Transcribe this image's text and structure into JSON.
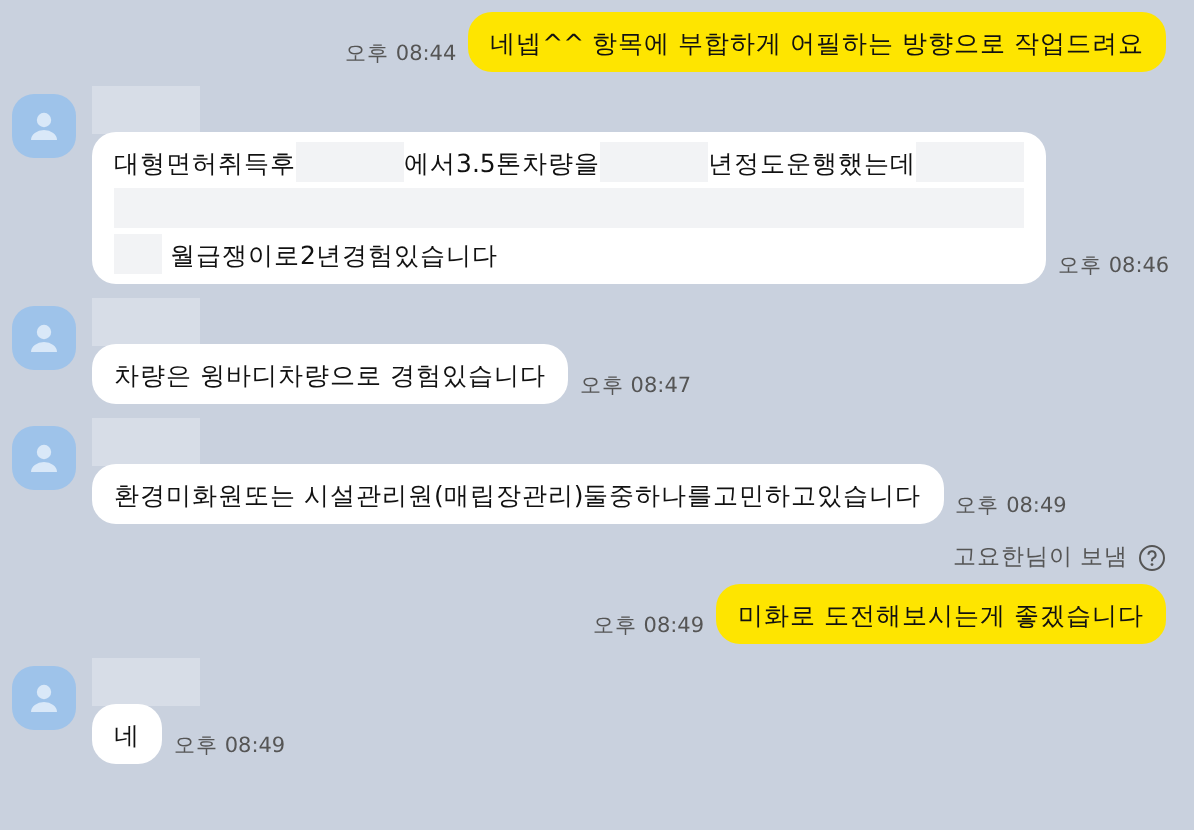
{
  "messages": [
    {
      "kind": "sent",
      "time": "오후 08:44",
      "lines": [
        [
          {
            "kind": "text",
            "text": "네넵^^ 항목에 부합하게 어필하는 방향으로 작업드려요"
          }
        ]
      ]
    },
    {
      "kind": "received",
      "time": "오후 08:46",
      "lines": [
        [
          {
            "kind": "text",
            "text": "대형면허취득후"
          },
          {
            "kind": "blur"
          },
          {
            "kind": "text",
            "text": "에서3.5톤차량을"
          },
          {
            "kind": "blur"
          },
          {
            "kind": "text",
            "text": "년정도운행했는데"
          },
          {
            "kind": "blur"
          }
        ],
        [
          {
            "kind": "blurline"
          }
        ],
        [
          {
            "kind": "blurshort"
          },
          {
            "kind": "text",
            "text": "월급쟁이로2년경험있습니다"
          }
        ]
      ]
    },
    {
      "kind": "received",
      "time": "오후 08:47",
      "lines": [
        [
          {
            "kind": "text",
            "text": "차량은 윙바디차량으로 경험있습니다"
          }
        ]
      ]
    },
    {
      "kind": "received",
      "time": "오후 08:49",
      "lines": [
        [
          {
            "kind": "text",
            "text": "환경미화원또는 시설관리원(매립장관리)둘중하나를고민하고있습니다"
          }
        ]
      ]
    },
    {
      "kind": "sent",
      "time": "오후 08:49",
      "note": "고요한님이 보냄",
      "lines": [
        [
          {
            "kind": "text",
            "text": "미화로 도전해보시는게 좋겠습니다"
          }
        ]
      ]
    },
    {
      "kind": "received",
      "time": "오후 08:49",
      "lines": [
        [
          {
            "kind": "text",
            "text": "네"
          }
        ]
      ]
    }
  ]
}
